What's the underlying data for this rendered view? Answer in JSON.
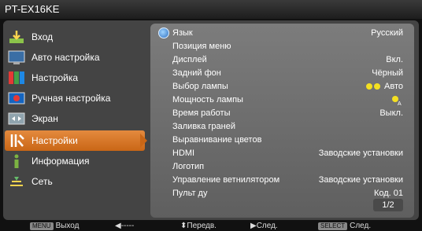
{
  "title": "PT-EX16KE",
  "sidebar": {
    "items": [
      {
        "label": "Вход",
        "icon": "input-icon",
        "active": false
      },
      {
        "label": "Авто настройка",
        "icon": "monitor-icon",
        "active": false
      },
      {
        "label": "Настройка",
        "icon": "palette-icon",
        "active": false
      },
      {
        "label": "Ручная настройка",
        "icon": "image-adjust-icon",
        "active": false
      },
      {
        "label": "Экран",
        "icon": "screen-icon",
        "active": false
      },
      {
        "label": "Настройки",
        "icon": "settings-tools-icon",
        "active": true
      },
      {
        "label": "Информация",
        "icon": "info-icon",
        "active": false
      },
      {
        "label": "Сеть",
        "icon": "network-icon",
        "active": false
      }
    ]
  },
  "settings": {
    "rows": [
      {
        "label": "Язык",
        "value": "Русский"
      },
      {
        "label": "Позиция меню",
        "value": ""
      },
      {
        "label": "Дисплей",
        "value": "Вкл."
      },
      {
        "label": "Задний фон",
        "value": "Чёрный"
      },
      {
        "label": "Выбор лампы",
        "value": "Авто"
      },
      {
        "label": "Мощность лампы",
        "value": ""
      },
      {
        "label": "Время работы",
        "value": "Выкл."
      },
      {
        "label": "Заливка граней",
        "value": ""
      },
      {
        "label": "Выравнивание цветов",
        "value": ""
      },
      {
        "label": "HDMI",
        "value": "Заводские установки"
      },
      {
        "label": "Логотип",
        "value": ""
      },
      {
        "label": "Управление ветнилятором",
        "value": "Заводские установки"
      },
      {
        "label": "Пульт ду",
        "value": "Код. 01"
      }
    ],
    "page": "1/2"
  },
  "footer": {
    "menu_key": "MENU",
    "exit": "Выход",
    "back_arrow": "◀-----",
    "updown": "⬍Передв.",
    "next": "▶След.",
    "select_key": "SELECT",
    "select_next": "След."
  },
  "colors": {
    "accent": "#d9762a",
    "panel": "#6e6e6e",
    "lamp": "#f4e021"
  }
}
